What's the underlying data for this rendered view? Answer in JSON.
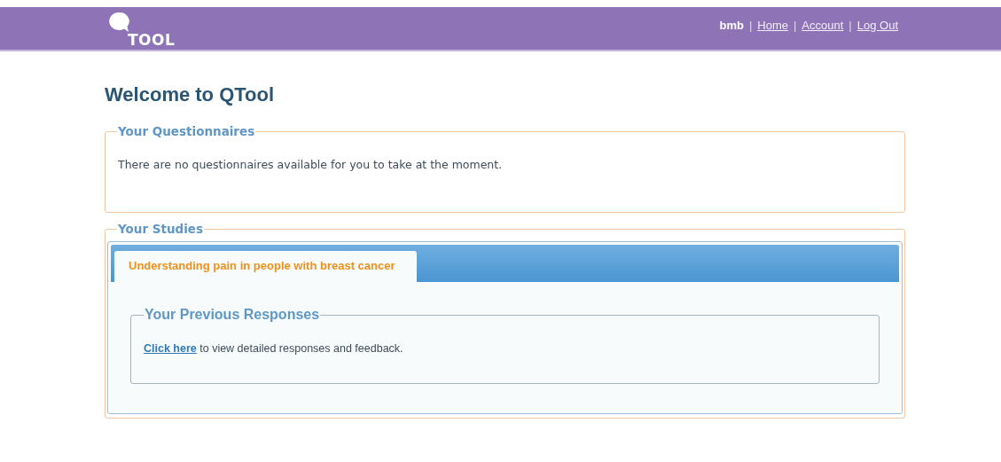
{
  "header": {
    "logo": "TOOL",
    "user": "bmb",
    "links": [
      "Home",
      "Account",
      "Log Out"
    ],
    "separators": [
      "|",
      "|",
      "|"
    ]
  },
  "title": "Welcome to QTool",
  "questionnaires": {
    "legend": "Your Questionnaires",
    "message": "There are no questionnaires available for you to take at the moment."
  },
  "studies": {
    "legend": "Your Studies",
    "tabs": [
      {
        "label": "Understanding pain in people with breast cancer",
        "selected": true
      }
    ],
    "responses": {
      "legend": "Your Previous Responses",
      "link": "Click here",
      "text": " to view detailed responses and feedback."
    }
  }
}
